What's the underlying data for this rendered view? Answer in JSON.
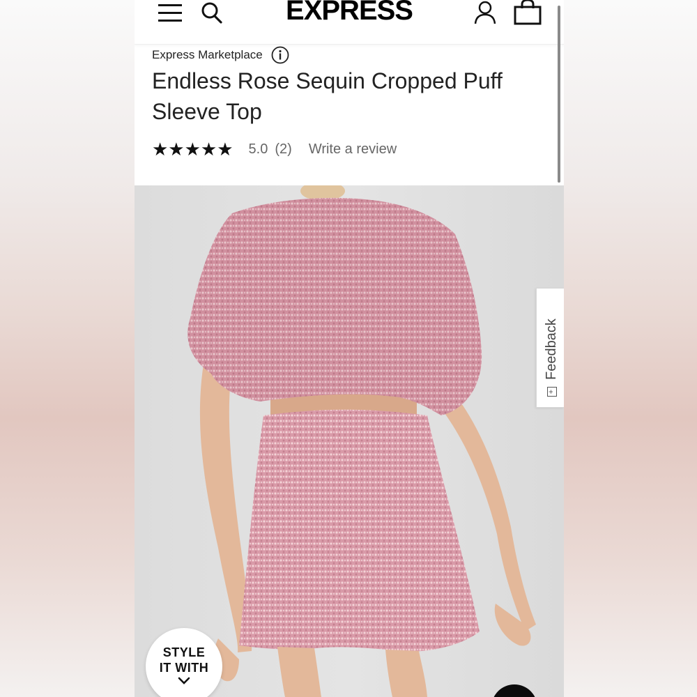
{
  "header": {
    "logo_text": "EXPRESS",
    "icons": [
      "menu-icon",
      "search-icon",
      "account-icon",
      "bag-icon"
    ]
  },
  "product": {
    "marketplace_label": "Express Marketplace",
    "title": "Endless Rose Sequin Cropped Puff Sleeve Top",
    "stars": "★★★★★",
    "rating": 5,
    "rating_text": "5.0",
    "review_count_text": "(2)",
    "write_review_label": "Write a review"
  },
  "image": {
    "description_icon": "product-photo"
  },
  "feedback": {
    "label": "Feedback",
    "glyph": "[+]"
  },
  "style_it_with": {
    "line1": "STYLE",
    "line2": "IT WITH"
  },
  "colors": {
    "sequin_pink": "#d99aa8",
    "sequin_highlight": "#f4d2d6",
    "skin": "#e3b89a",
    "text_dark": "#222222",
    "text_gray": "#666666"
  }
}
